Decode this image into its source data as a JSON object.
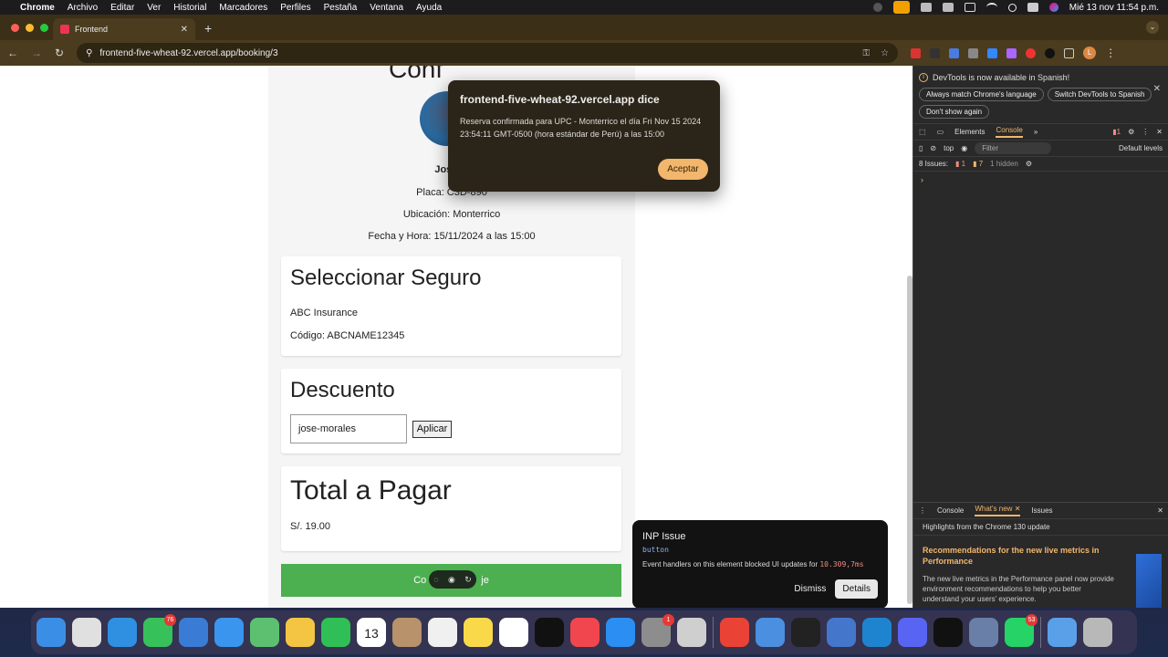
{
  "menubar": {
    "app": "Chrome",
    "items": [
      "Archivo",
      "Editar",
      "Ver",
      "Historial",
      "Marcadores",
      "Perfiles",
      "Pestaña",
      "Ventana",
      "Ayuda"
    ],
    "clock": "Mié 13 nov 11:54 p.m."
  },
  "browser": {
    "tab_title": "Frontend",
    "url": "frontend-five-wheat-92.vercel.app/booking/3",
    "avatar_letter": "L"
  },
  "page": {
    "heading_partial": "Conf",
    "user_name": "José M",
    "plate": "Placa: C3D-890",
    "location": "Ubicación: Monterrico",
    "datetime": "Fecha y Hora: 15/11/2024 a las 15:00",
    "insurance": {
      "title": "Seleccionar Seguro",
      "company": "ABC Insurance",
      "code": "Código: ABCNAME12345"
    },
    "discount": {
      "title": "Descuento",
      "input_value": "jose-morales",
      "apply_label": "Aplicar"
    },
    "total": {
      "title": "Total a Pagar",
      "amount": "S/. 19.00"
    },
    "pay_button_left": "Co",
    "pay_button_right": "je"
  },
  "dialog": {
    "title": "frontend-five-wheat-92.vercel.app dice",
    "message": "Reserva confirmada para UPC - Monterrico el día Fri Nov 15 2024 23:54:11 GMT-0500 (hora estándar de Perú) a las 15:00",
    "ok_label": "Aceptar"
  },
  "inp_popup": {
    "title": "INP Issue",
    "element": "button",
    "desc": "Event handlers on this element blocked UI updates for",
    "ms": "10.309,7ms",
    "dismiss": "Dismiss",
    "details": "Details"
  },
  "devtools": {
    "info_msg": "DevTools is now available in Spanish!",
    "btn_match": "Always match Chrome's language",
    "btn_switch": "Switch DevTools to Spanish",
    "btn_dont": "Don't show again",
    "tab_elements": "Elements",
    "tab_console": "Console",
    "issues_count_badge": "1",
    "context": "top",
    "filter_placeholder": "Filter",
    "levels": "Default levels",
    "issues_label": "8 Issues:",
    "issues_err": "1",
    "issues_warn": "7",
    "hidden": "1 hidden",
    "drawer_console": "Console",
    "drawer_whats_new": "What's new",
    "drawer_issues": "Issues",
    "drawer_sub": "Highlights from the Chrome 130 update",
    "drawer_heading": "Recommendations for the new live metrics in Performance",
    "drawer_text": "The new live metrics in the Performance panel now provide environment recommendations to help you better understand your users' experience."
  },
  "dock": {
    "apps": [
      {
        "name": "finder",
        "color": "#3b8ee6"
      },
      {
        "name": "launchpad",
        "color": "#e0e0e0"
      },
      {
        "name": "safari",
        "color": "#2f8fe0"
      },
      {
        "name": "messages",
        "color": "#37c15a",
        "badge": "76"
      },
      {
        "name": "xcode",
        "color": "#3a7bd5"
      },
      {
        "name": "mail",
        "color": "#3a95ef"
      },
      {
        "name": "maps",
        "color": "#5cc070"
      },
      {
        "name": "photos",
        "color": "#f4c542"
      },
      {
        "name": "facetime",
        "color": "#2fbf56"
      },
      {
        "name": "calendar",
        "color": "#ffffff",
        "label": "13"
      },
      {
        "name": "contacts",
        "color": "#b7926b"
      },
      {
        "name": "reminders",
        "color": "#f0f0f0"
      },
      {
        "name": "notes",
        "color": "#f9d94a"
      },
      {
        "name": "freeform",
        "color": "#ffffff"
      },
      {
        "name": "tv",
        "color": "#111111"
      },
      {
        "name": "music",
        "color": "#f2464f"
      },
      {
        "name": "app-store",
        "color": "#2b8ef2"
      },
      {
        "name": "settings",
        "color": "#8d8d8d",
        "badge": "1"
      },
      {
        "name": "iphone-mirroring",
        "color": "#cfcfcf"
      },
      {
        "name": "chrome",
        "color": "#ea4335"
      },
      {
        "name": "simulator",
        "color": "#4a8fe0"
      },
      {
        "name": "terminal",
        "color": "#222222"
      },
      {
        "name": "instruments",
        "color": "#4477cc"
      },
      {
        "name": "vscode",
        "color": "#1f84d0"
      },
      {
        "name": "discord",
        "color": "#5865f2"
      },
      {
        "name": "webstorm",
        "color": "#111111"
      },
      {
        "name": "mysql-workbench",
        "color": "#6a7fa8"
      },
      {
        "name": "whatsapp",
        "color": "#25d366",
        "badge": "53"
      },
      {
        "name": "downloads-folder",
        "color": "#5aa0e8"
      },
      {
        "name": "trash",
        "color": "#b8b8b8"
      }
    ]
  }
}
